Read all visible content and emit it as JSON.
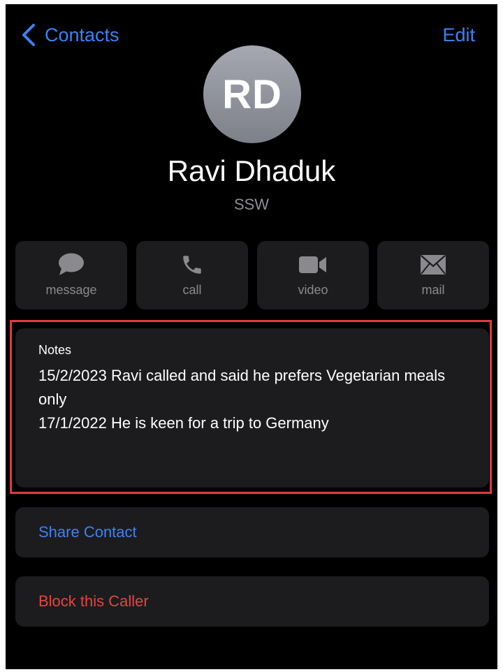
{
  "nav": {
    "back_label": "Contacts",
    "edit_label": "Edit"
  },
  "contact": {
    "initials": "RD",
    "name": "Ravi Dhaduk",
    "company": "SSW"
  },
  "actions": [
    {
      "label": "message",
      "icon": "message-icon"
    },
    {
      "label": "call",
      "icon": "phone-icon"
    },
    {
      "label": "video",
      "icon": "video-icon"
    },
    {
      "label": "mail",
      "icon": "mail-icon"
    }
  ],
  "notes": {
    "title": "Notes",
    "lines": [
      "15/2/2023 Ravi called and said he prefers Vegetarian meals only",
      "17/1/2022 He is keen for a trip to Germany"
    ]
  },
  "share_label": "Share Contact",
  "block_label": "Block this Caller",
  "colors": {
    "accent": "#3b82f6",
    "destructive": "#e5453f",
    "highlight_border": "#e03a3e",
    "card_background": "#1c1c1e"
  }
}
